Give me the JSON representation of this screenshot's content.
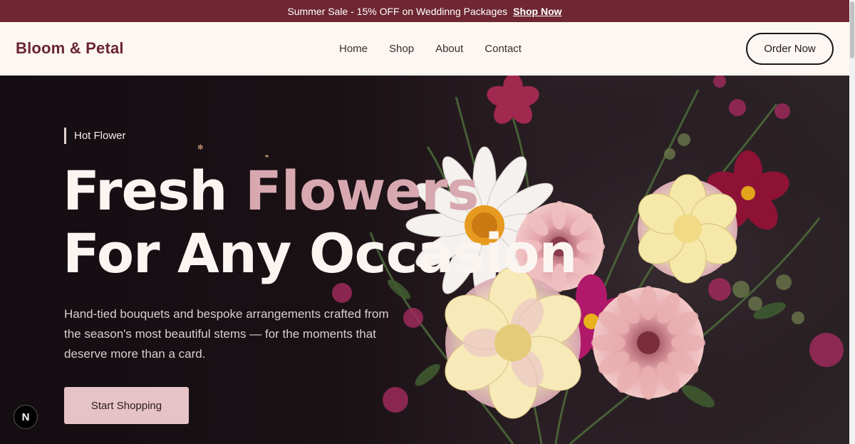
{
  "announcement": {
    "text": "Summer Sale - 15% OFF on Weddinng Packages",
    "link": "Shop Now"
  },
  "navbar": {
    "brand": "Bloom & Petal",
    "links": [
      "Home",
      "Shop",
      "About",
      "Contact"
    ],
    "cta": "Order Now"
  },
  "hero": {
    "eyebrow": "Hot Flower",
    "headline_line1_plain": "Fresh ",
    "headline_line1_accent": "Flowers",
    "headline_line2": "For Any Occasion",
    "description": "Hand-tied bouquets and bespoke arrangements crafted from the season's most beautiful stems — for the moments that deserve more than a card.",
    "button": "Start Shopping"
  },
  "badge": {
    "label": "N"
  },
  "colors": {
    "announcement_bg": "#6e2733",
    "brand": "#6a2530",
    "nav_bg": "#fcf7f2",
    "accent_pink": "#d8a8b0",
    "cta_bg": "#e6c3c7"
  }
}
